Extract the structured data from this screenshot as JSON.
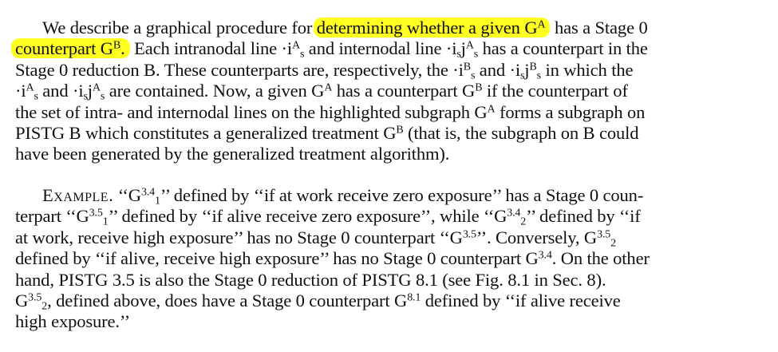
{
  "paragraph1": {
    "l1": [
      "We describe a graphical procedure for ",
      "determining whether a given G",
      "A",
      " has a Stage 0"
    ],
    "l2": [
      "counterpart G",
      "B",
      ".",
      " Each intranodal line ·i",
      "A",
      "s",
      " and internodal line ·i",
      "s",
      "j",
      "A",
      "s",
      " has a counterpart in the"
    ],
    "l3": [
      "Stage 0 reduction B. These counterparts are, respectively, the ·i",
      "B",
      "s",
      " and ·i",
      "s",
      "j",
      "B",
      "s",
      " in which the"
    ],
    "l4": [
      "·i",
      "A",
      "s",
      " and ·i",
      "s",
      "j",
      "A",
      "s",
      " are contained. Now, a given G",
      "A",
      " has a counterpart G",
      "B",
      " if the counterpart of"
    ],
    "l5": "the set of intra- and internodal lines on the highlighted subgraph G^A forms a subgraph on",
    "l5a": "the set of intra- and internodal lines on the highlighted subgraph G",
    "l5b": " forms a subgraph on",
    "l6a": "PISTG B which constitutes a generalized treatment G",
    "l6b": " (that is, the subgraph on B could",
    "l7": "have been generated by the generalized treatment algorithm)."
  },
  "paragraph2": {
    "l1a": "Example.",
    "l1b": "  ‘‘G",
    "l1c": "3.4",
    "l1d": "1",
    "l1e": "’’ defined by ‘‘if at work receive zero exposure’’ has a Stage 0 coun-",
    "l2a": "terpart ‘‘G",
    "l2b": "3.5",
    "l2c": "1",
    "l2d": "’’ defined by ‘‘if alive receive zero exposure’’, while ‘‘G",
    "l2e": "3.4",
    "l2f": "2",
    "l2g": "’’ defined by ‘‘if",
    "l3a": "at work, receive high exposure’’ has no Stage 0 counterpart ‘‘G",
    "l3b": "3.5",
    "l3c": "’’. Conversely, G",
    "l3d": "3.5",
    "l3e": "2",
    "l4a": "defined by ‘‘if alive, receive high exposure’’ has no Stage 0 counterpart G",
    "l4b": "3.4",
    "l4c": ". On the other",
    "l5": "hand, PISTG 3.5 is also the Stage 0 reduction of PISTG 8.1 (see Fig. 8.1 in Sec. 8).",
    "l6a": "G",
    "l6b": "3.5",
    "l6c": "2",
    "l6d": ", defined above, does have a Stage 0 counterpart G",
    "l6e": "8.1",
    "l6f": " defined by ‘‘if alive receive",
    "l7": "high exposure.’’"
  },
  "highlight_color": "#ffff22"
}
